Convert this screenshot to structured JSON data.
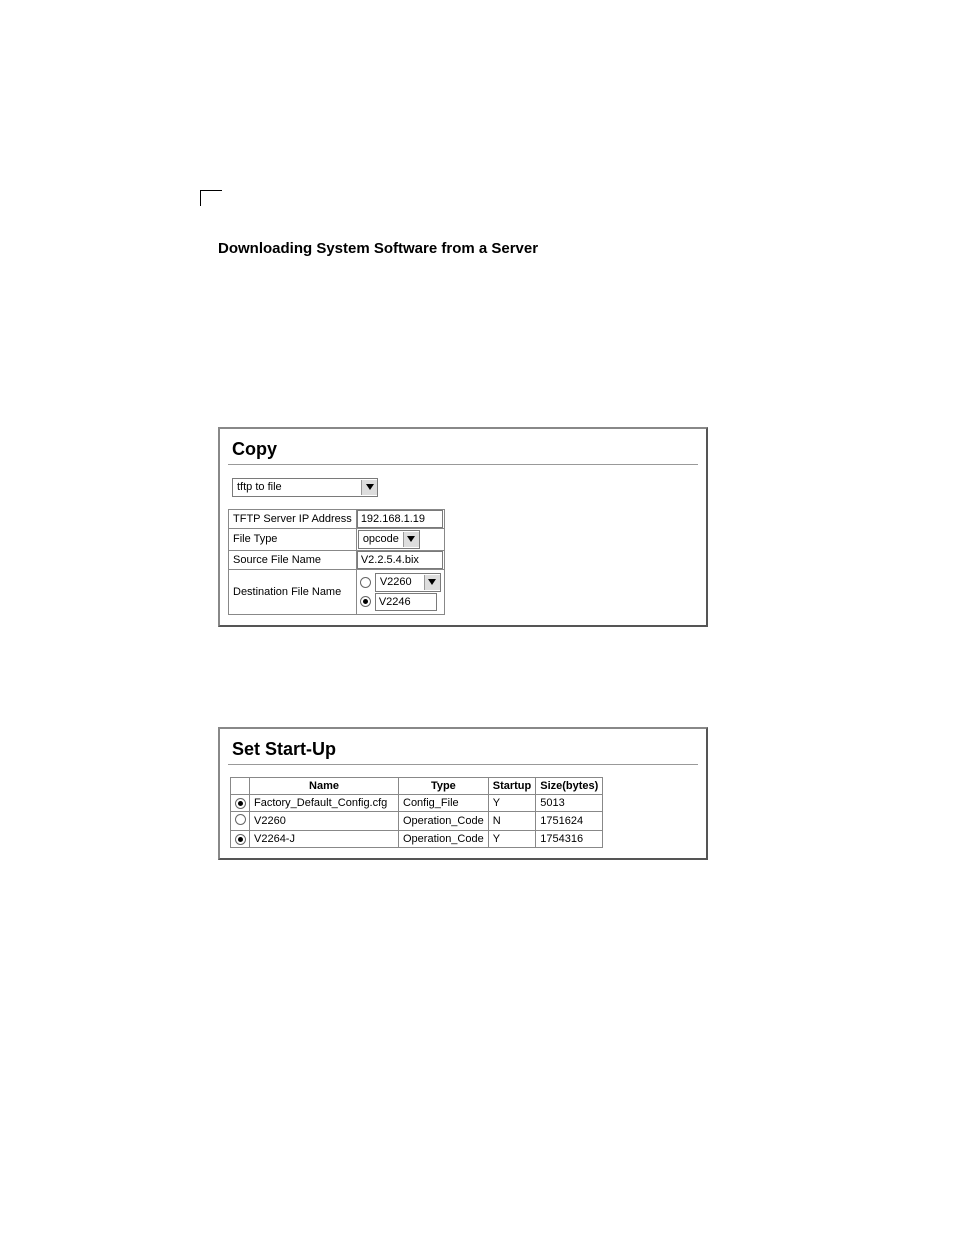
{
  "heading": "Downloading System Software from a Server",
  "copy_panel": {
    "title": "Copy",
    "mode_select_value": "tftp to file",
    "fields": {
      "tftp_ip_label": "TFTP Server IP Address",
      "tftp_ip_value": "192.168.1.19",
      "file_type_label": "File Type",
      "file_type_value": "opcode",
      "source_label": "Source File Name",
      "source_value": "V2.2.5.4.bix",
      "dest_label": "Destination File Name",
      "dest_select_value": "V2260",
      "dest_text_value": "V2246",
      "dest_radio_selected_index": 1
    }
  },
  "startup_panel": {
    "title": "Set Start-Up",
    "headers": {
      "radio": "",
      "name": "Name",
      "type": "Type",
      "startup": "Startup",
      "size": "Size(bytes)"
    },
    "rows": [
      {
        "selected": true,
        "name": "Factory_Default_Config.cfg",
        "type": "Config_File",
        "startup": "Y",
        "size": "5013"
      },
      {
        "selected": false,
        "name": "V2260",
        "type": "Operation_Code",
        "startup": "N",
        "size": "1751624"
      },
      {
        "selected": true,
        "name": "V2264-J",
        "type": "Operation_Code",
        "startup": "Y",
        "size": "1754316"
      }
    ]
  }
}
